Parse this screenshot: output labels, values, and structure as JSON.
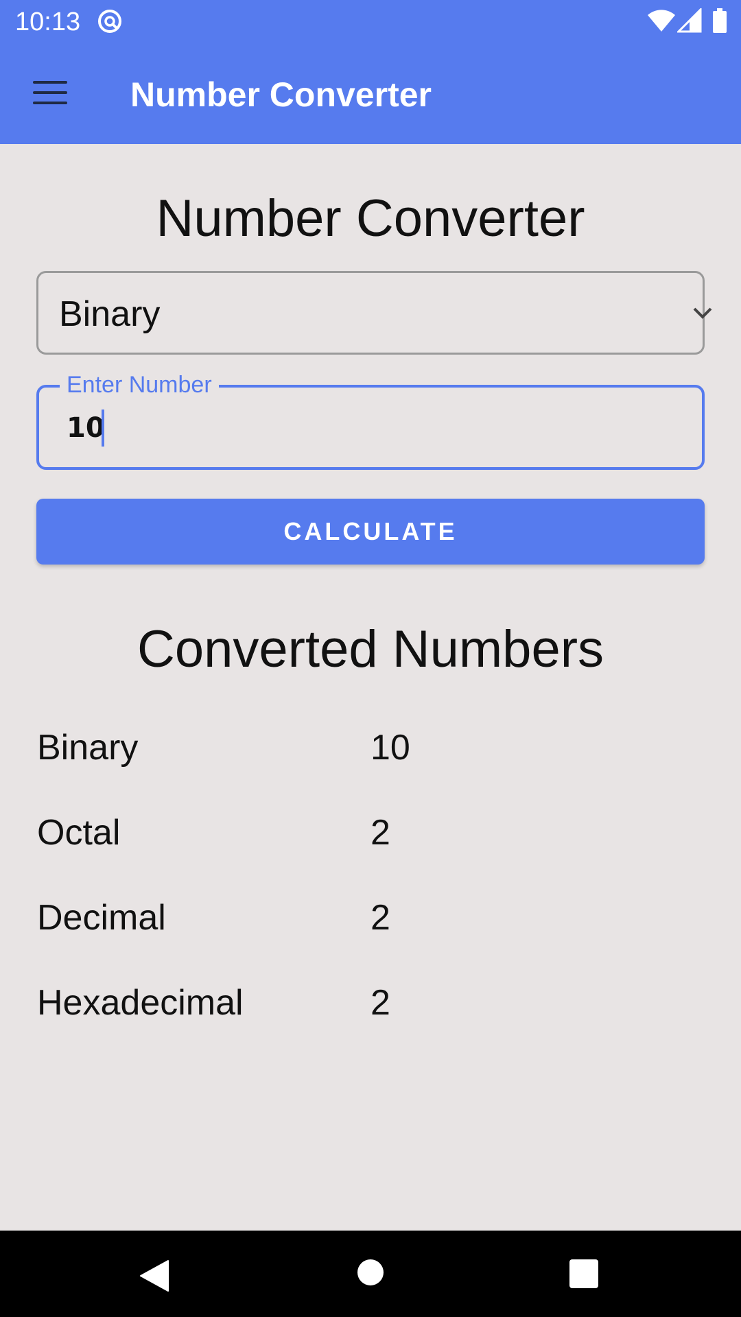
{
  "status_bar": {
    "time": "10:13"
  },
  "app_bar": {
    "title": "Number Converter"
  },
  "main": {
    "title": "Number Converter",
    "base_select": {
      "selected": "Binary"
    },
    "number_input": {
      "label": "Enter Number",
      "value": "10"
    },
    "calculate_label": "CALCULATE",
    "results_title": "Converted Numbers",
    "results": [
      {
        "label": "Binary",
        "value": "10"
      },
      {
        "label": "Octal",
        "value": "2"
      },
      {
        "label": "Decimal",
        "value": "2"
      },
      {
        "label": "Hexadecimal",
        "value": "2"
      }
    ]
  },
  "colors": {
    "primary": "#567bee",
    "background": "#e8e4e4",
    "text": "#111111",
    "nav_bar": "#000000"
  }
}
